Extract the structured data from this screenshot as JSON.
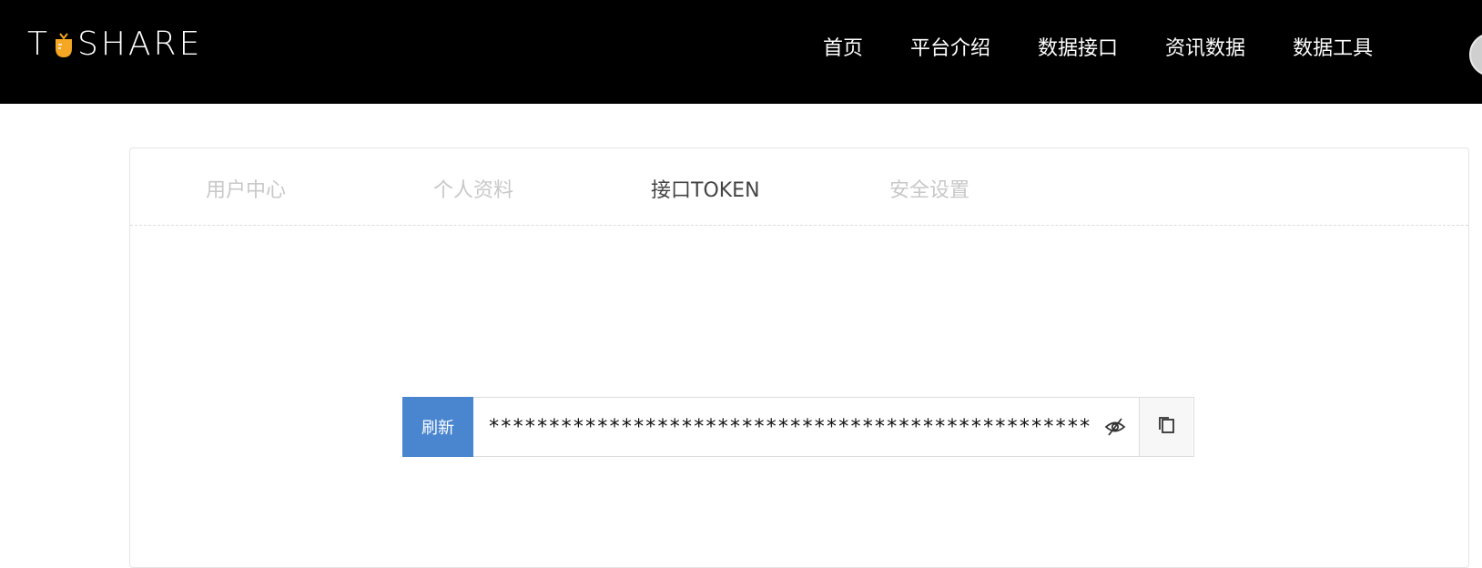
{
  "header": {
    "logo_left": "T",
    "logo_right": "SHARE",
    "nav": [
      "首页",
      "平台介绍",
      "数据接口",
      "资讯数据",
      "数据工具"
    ]
  },
  "tabs": [
    {
      "label": "用户中心",
      "active": false
    },
    {
      "label": "个人资料",
      "active": false
    },
    {
      "label": "接口TOKEN",
      "active": true
    },
    {
      "label": "安全设置",
      "active": false
    }
  ],
  "token": {
    "refresh_label": "刷新",
    "masked_value": "**************************************************"
  },
  "colors": {
    "header_bg": "#000000",
    "refresh_bg": "#4a86cf",
    "logo_accent": "#f5a623"
  },
  "icons": {
    "eye": "eye-slash-icon",
    "copy": "copy-icon",
    "logo": "carrot-icon"
  }
}
